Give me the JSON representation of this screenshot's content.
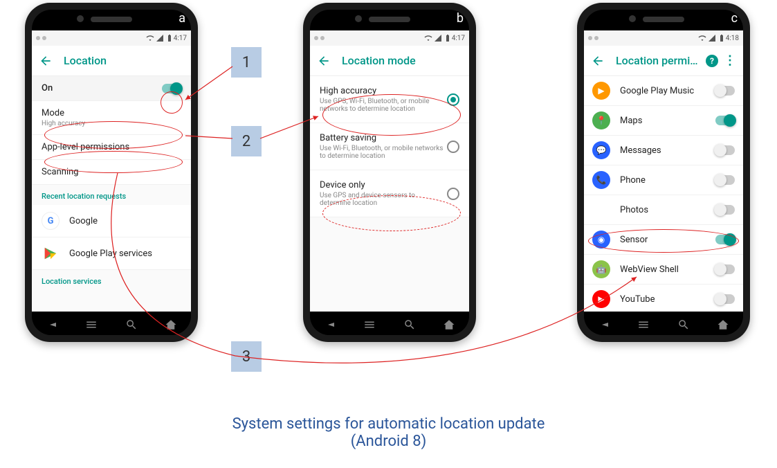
{
  "caption_line1": "System settings for automatic location update",
  "caption_line2": "(Android 8)",
  "steps": {
    "s1": "1",
    "s2": "2",
    "s3": "3"
  },
  "phones": {
    "a": {
      "label": "a",
      "time": "4:17",
      "title": "Location",
      "on_label": "On",
      "items": [
        {
          "title": "Mode",
          "sub": "High accuracy"
        },
        {
          "title": "App-level permissions",
          "sub": ""
        },
        {
          "title": "Scanning",
          "sub": ""
        }
      ],
      "section1": "Recent location requests",
      "recent": [
        {
          "title": "Google"
        },
        {
          "title": "Google Play services"
        }
      ],
      "section2": "Location services"
    },
    "b": {
      "label": "b",
      "time": "4:17",
      "title": "Location mode",
      "options": [
        {
          "title": "High accuracy",
          "sub": "Use GPS, Wi-Fi, Bluetooth, or mobile networks to determine location",
          "on": true
        },
        {
          "title": "Battery saving",
          "sub": "Use Wi-Fi, Bluetooth, or mobile networks to determine location",
          "on": false
        },
        {
          "title": "Device only",
          "sub": "Use GPS and device sensors to determine location",
          "on": false
        }
      ]
    },
    "c": {
      "label": "c",
      "time": "4:18",
      "title": "Location permi…",
      "apps": [
        {
          "title": "Google Play Music",
          "on": false,
          "bg": "#ff9800",
          "glyph": "▶"
        },
        {
          "title": "Maps",
          "on": true,
          "bg": "#4caf50",
          "glyph": "📍"
        },
        {
          "title": "Messages",
          "on": false,
          "bg": "#2962ff",
          "glyph": "💬"
        },
        {
          "title": "Phone",
          "on": false,
          "bg": "#2962ff",
          "glyph": "📞"
        },
        {
          "title": "Photos",
          "on": false,
          "bg": "#fff",
          "glyph": "✦"
        },
        {
          "title": "Sensor",
          "on": true,
          "bg": "#2962ff",
          "glyph": "◉"
        },
        {
          "title": "WebView Shell",
          "on": false,
          "bg": "#8bc34a",
          "glyph": "🤖"
        },
        {
          "title": "YouTube",
          "on": false,
          "bg": "#f00",
          "glyph": "▶"
        }
      ]
    }
  }
}
